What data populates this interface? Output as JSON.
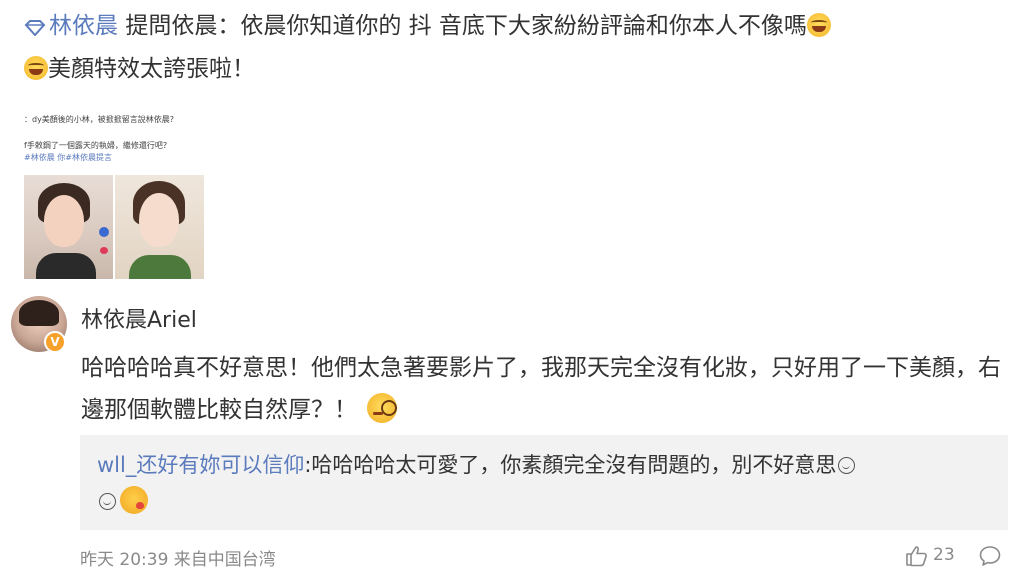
{
  "question": {
    "asker": "林依晨",
    "prefix": "提問依晨：",
    "text_part1": "依晨你知道你的 抖 音底下大家紛紛評論和你本人不像嗎",
    "text_part2": "美顏特效太誇張啦！",
    "asker_icon": "diamond-icon",
    "emoji": "laughing-tears-emoji"
  },
  "attached_image": {
    "line1": "：dy美顏後的小林，被掀掀留言說林依晨?",
    "line2": "f手敕鋼了一個露天的執婦，繼修還行吧?",
    "tags": "#林依晨 你#林依晨提言"
  },
  "reply": {
    "username": "林依晨Ariel",
    "text": "哈哈哈哈真不好意思！他們太急著要影片了，我那天完全沒有化妝，只好用了一下美顏，右邊那個軟體比較自然厚？！",
    "emoji": "monocle-emoji",
    "verified_badge": "V"
  },
  "subreply": {
    "user": "wll_还好有妳可以信仰",
    "text": ":哈哈哈哈太可愛了，你素顏完全沒有問題的，別不好意思"
  },
  "footer": {
    "time": "昨天 20:39 来自中国台湾",
    "likes": "23"
  },
  "colors": {
    "link": "#5b7bbd",
    "text": "#333333",
    "meta": "#8a8a8a",
    "quote_bg": "#f2f2f2",
    "verified": "#f7a12a"
  }
}
